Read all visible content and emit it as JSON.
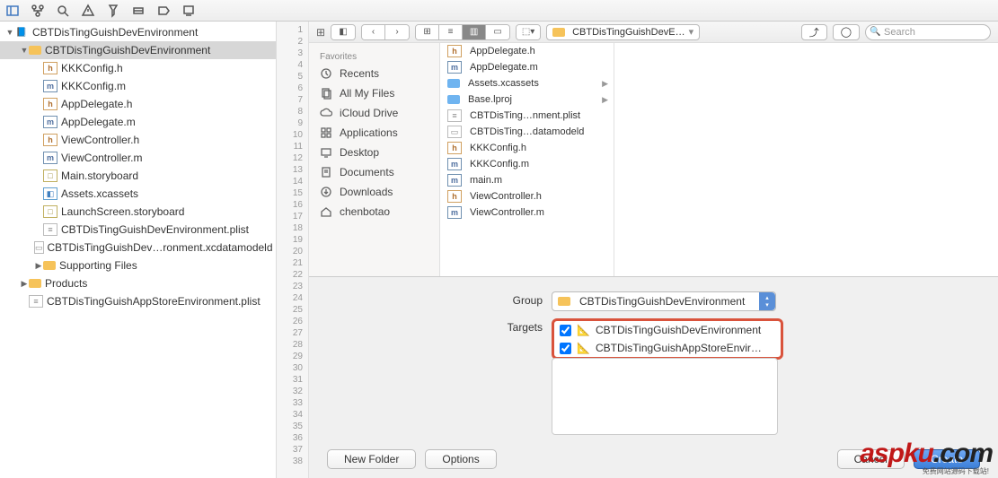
{
  "project": {
    "root": "CBTDisTingGuishDevEnvironment",
    "tree": [
      {
        "indent": 0,
        "icon": "proj",
        "label": "CBTDisTingGuishDevEnvironment",
        "disclosure": "▼",
        "sel": false
      },
      {
        "indent": 1,
        "icon": "folder",
        "label": "CBTDisTingGuishDevEnvironment",
        "disclosure": "▼",
        "sel": true
      },
      {
        "indent": 2,
        "icon": "h",
        "label": "KKKConfig.h",
        "sel": false,
        "iconText": "h"
      },
      {
        "indent": 2,
        "icon": "m",
        "label": "KKKConfig.m",
        "sel": false,
        "iconText": "m"
      },
      {
        "indent": 2,
        "icon": "h",
        "label": "AppDelegate.h",
        "sel": false,
        "iconText": "h"
      },
      {
        "indent": 2,
        "icon": "m",
        "label": "AppDelegate.m",
        "sel": false,
        "iconText": "m"
      },
      {
        "indent": 2,
        "icon": "h",
        "label": "ViewController.h",
        "sel": false,
        "iconText": "h"
      },
      {
        "indent": 2,
        "icon": "m",
        "label": "ViewController.m",
        "sel": false,
        "iconText": "m"
      },
      {
        "indent": 2,
        "icon": "story",
        "label": "Main.storyboard",
        "sel": false,
        "iconText": "□"
      },
      {
        "indent": 2,
        "icon": "xc",
        "label": "Assets.xcassets",
        "sel": false,
        "iconText": "◧"
      },
      {
        "indent": 2,
        "icon": "story",
        "label": "LaunchScreen.storyboard",
        "sel": false,
        "iconText": "□"
      },
      {
        "indent": 2,
        "icon": "plist",
        "label": "CBTDisTingGuishDevEnvironment.plist",
        "sel": false,
        "iconText": "≡"
      },
      {
        "indent": 2,
        "icon": "model",
        "label": "CBTDisTingGuishDev…ronment.xcdatamodeld",
        "sel": false,
        "iconText": "▭"
      },
      {
        "indent": 2,
        "icon": "folder",
        "label": "Supporting Files",
        "disclosure": "▶",
        "sel": false
      },
      {
        "indent": 1,
        "icon": "folder",
        "label": "Products",
        "disclosure": "▶",
        "sel": false
      },
      {
        "indent": 1,
        "icon": "plist",
        "label": "CBTDisTingGuishAppStoreEnvironment.plist",
        "sel": false,
        "iconText": "≡"
      }
    ]
  },
  "gutter": {
    "start": 1,
    "end": 38
  },
  "finder": {
    "pathLabel": "CBTDisTingGuishDevE…",
    "searchPlaceholder": "Search",
    "favoritesTitle": "Favorites",
    "favorites": [
      {
        "icon": "clock",
        "label": "Recents"
      },
      {
        "icon": "files",
        "label": "All My Files"
      },
      {
        "icon": "cloud",
        "label": "iCloud Drive"
      },
      {
        "icon": "apps",
        "label": "Applications"
      },
      {
        "icon": "desktop",
        "label": "Desktop"
      },
      {
        "icon": "doc",
        "label": "Documents"
      },
      {
        "icon": "download",
        "label": "Downloads"
      },
      {
        "icon": "home",
        "label": "chenbotao"
      }
    ],
    "column": [
      {
        "icon": "h",
        "label": "AppDelegate.h",
        "iconText": "h"
      },
      {
        "icon": "m",
        "label": "AppDelegate.m",
        "iconText": "m"
      },
      {
        "icon": "folder",
        "label": "Assets.xcassets",
        "arrow": true
      },
      {
        "icon": "folder",
        "label": "Base.lproj",
        "arrow": true
      },
      {
        "icon": "plist",
        "label": "CBTDisTing…nment.plist",
        "iconText": "≡"
      },
      {
        "icon": "model",
        "label": "CBTDisTing…datamodeld",
        "iconText": "▭"
      },
      {
        "icon": "h",
        "label": "KKKConfig.h",
        "iconText": "h"
      },
      {
        "icon": "m",
        "label": "KKKConfig.m",
        "iconText": "m"
      },
      {
        "icon": "m",
        "label": "main.m",
        "iconText": "m"
      },
      {
        "icon": "h",
        "label": "ViewController.h",
        "iconText": "h"
      },
      {
        "icon": "m",
        "label": "ViewController.m",
        "iconText": "m"
      }
    ]
  },
  "sheet": {
    "groupLabel": "Group",
    "groupValue": "CBTDisTingGuishDevEnvironment",
    "targetsLabel": "Targets",
    "targets": [
      {
        "checked": true,
        "label": "CBTDisTingGuishDevEnvironment"
      },
      {
        "checked": true,
        "label": "CBTDisTingGuishAppStoreEnvir…"
      }
    ],
    "newFolder": "New Folder",
    "options": "Options",
    "cancel": "Cancel",
    "create": "Create"
  },
  "watermark": {
    "text": "aspku",
    "suffix": ".com",
    "sub": "免费网站源码下载站!"
  }
}
